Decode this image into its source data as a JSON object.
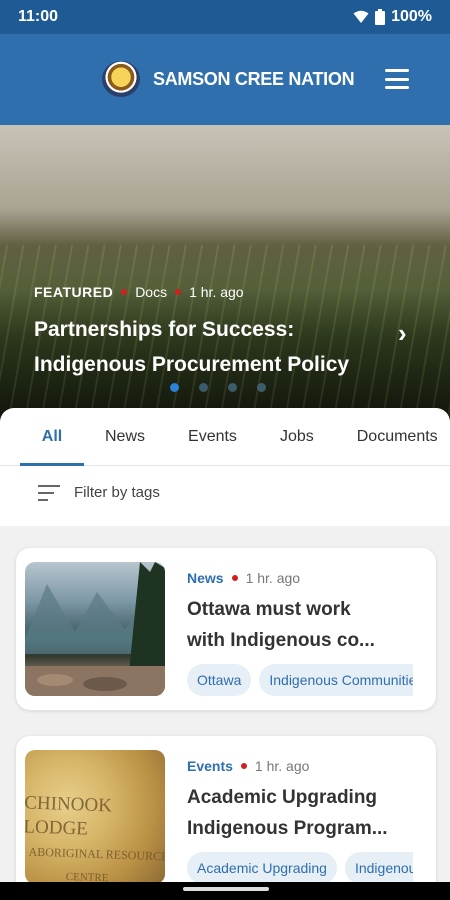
{
  "status_bar": {
    "time": "11:00",
    "battery": "100%"
  },
  "header": {
    "title": "SAMSON CREE NATION",
    "menu_icon": "hamburger-menu-icon"
  },
  "hero": {
    "label": "FEATURED",
    "category": "Docs",
    "time": "1 hr. ago",
    "title_line1": "Partnerships for Success:",
    "title_line2": "Indigenous Procurement Policy",
    "next_icon": "chevron-right-icon",
    "dots": 4,
    "active_dot": 0
  },
  "tabs": [
    {
      "label": "All",
      "active": true
    },
    {
      "label": "News",
      "active": false
    },
    {
      "label": "Events",
      "active": false
    },
    {
      "label": "Jobs",
      "active": false
    },
    {
      "label": "Documents",
      "active": false
    }
  ],
  "filter": {
    "label": "Filter by tags",
    "icon": "filter-icon"
  },
  "cards": [
    {
      "category": "News",
      "time": "1 hr. ago",
      "title_line1": "Ottawa must work",
      "title_line2": "with Indigenous co...",
      "tags": [
        "Ottawa",
        "Indigenous Communities"
      ]
    },
    {
      "category": "Events",
      "time": "1 hr. ago",
      "title_line1": "Academic Upgrading",
      "title_line2": "Indigenous Program...",
      "tags": [
        "Academic Upgrading",
        "Indigenous"
      ],
      "image_text": [
        "CHINOOK LODGE",
        "ABORIGINAL RESOURCE",
        "CENTRE"
      ]
    }
  ],
  "colors": {
    "brand_blue": "#2f6fae",
    "status_bar": "#1e5a94",
    "accent_red": "#d02020"
  }
}
